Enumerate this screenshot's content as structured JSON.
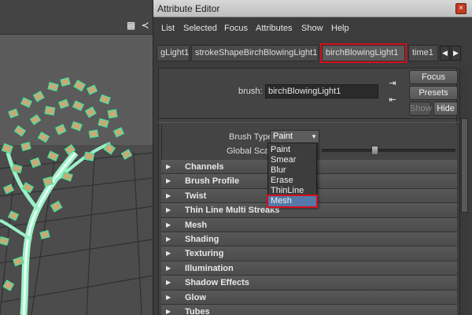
{
  "window": {
    "title": "Attribute Editor",
    "close_label": "×"
  },
  "menubar": {
    "items": [
      "List",
      "Selected",
      "Focus",
      "Attributes",
      "Show",
      "Help"
    ]
  },
  "tabs": [
    {
      "label": "gLight1",
      "active": false
    },
    {
      "label": "strokeShapeBirchBlowingLight1",
      "active": false
    },
    {
      "label": "birchBlowingLight1",
      "active": true,
      "highlighted": true
    },
    {
      "label": "time1",
      "active": false
    }
  ],
  "node": {
    "label": "brush:",
    "value": "birchBlowingLight1"
  },
  "buttons": {
    "focus": "Focus",
    "presets": "Presets",
    "show": "Show",
    "hide": "Hide"
  },
  "brush_type": {
    "label": "Brush Type",
    "selected": "Paint",
    "options": [
      "Paint",
      "Smear",
      "Blur",
      "Erase",
      "ThinLine",
      "Mesh"
    ],
    "highlighted_option": "Mesh"
  },
  "global_scale": {
    "label": "Global Scale",
    "level": 0.36
  },
  "sections": [
    "Channels",
    "Brush Profile",
    "Twist",
    "Thin Line Multi Streaks",
    "Mesh",
    "Shading",
    "Texturing",
    "Illumination",
    "Shadow Effects",
    "Glow",
    "Tubes"
  ],
  "colors": {
    "highlight_red": "#d40f1d",
    "selection_blue": "#5479a8",
    "foliage_green": "#41e39a"
  },
  "icons": {
    "tab_prev": "◀",
    "tab_next": "▶",
    "frame_collapsed": "▶",
    "dropdown_arrow": "▼"
  }
}
